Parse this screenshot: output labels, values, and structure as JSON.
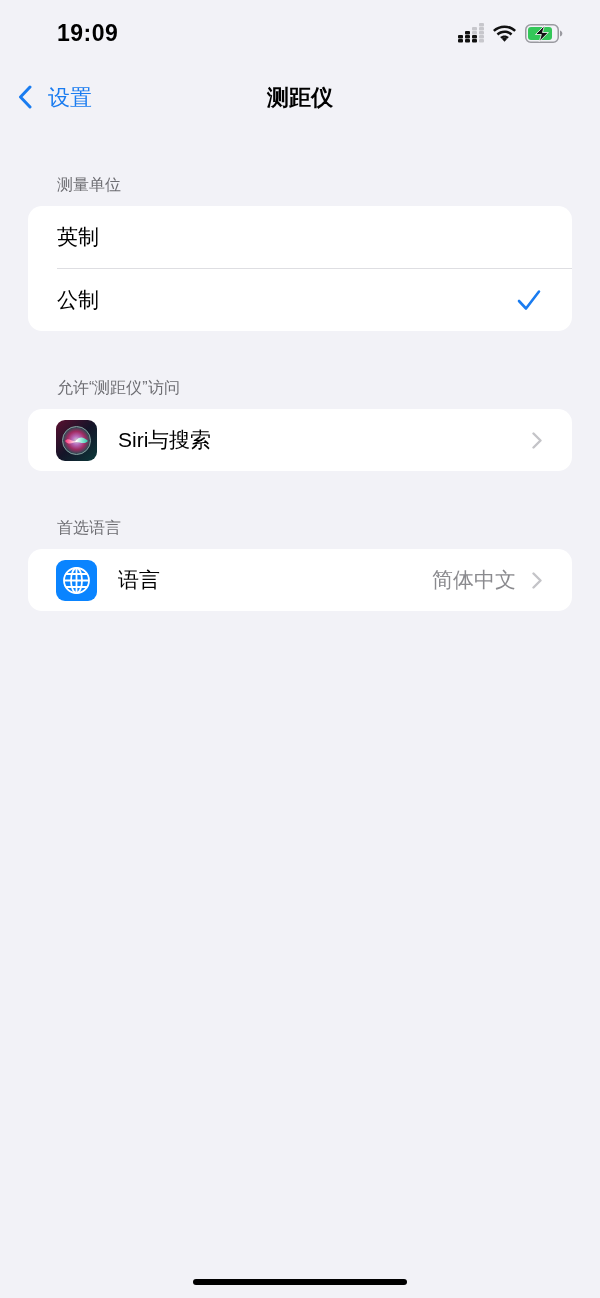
{
  "status_bar": {
    "time": "19:09"
  },
  "nav": {
    "back": "设置",
    "title": "测距仪"
  },
  "sections": [
    {
      "header": "测量单位",
      "rows": [
        {
          "kind": "option",
          "label": "英制",
          "selected": false
        },
        {
          "kind": "option",
          "label": "公制",
          "selected": true
        }
      ]
    },
    {
      "header": "允许“测距仪”访问",
      "rows": [
        {
          "kind": "link",
          "label": "Siri与搜索"
        }
      ]
    },
    {
      "header": "首选语言",
      "rows": [
        {
          "kind": "link",
          "label": "语言",
          "value": "简体中文"
        }
      ]
    }
  ]
}
